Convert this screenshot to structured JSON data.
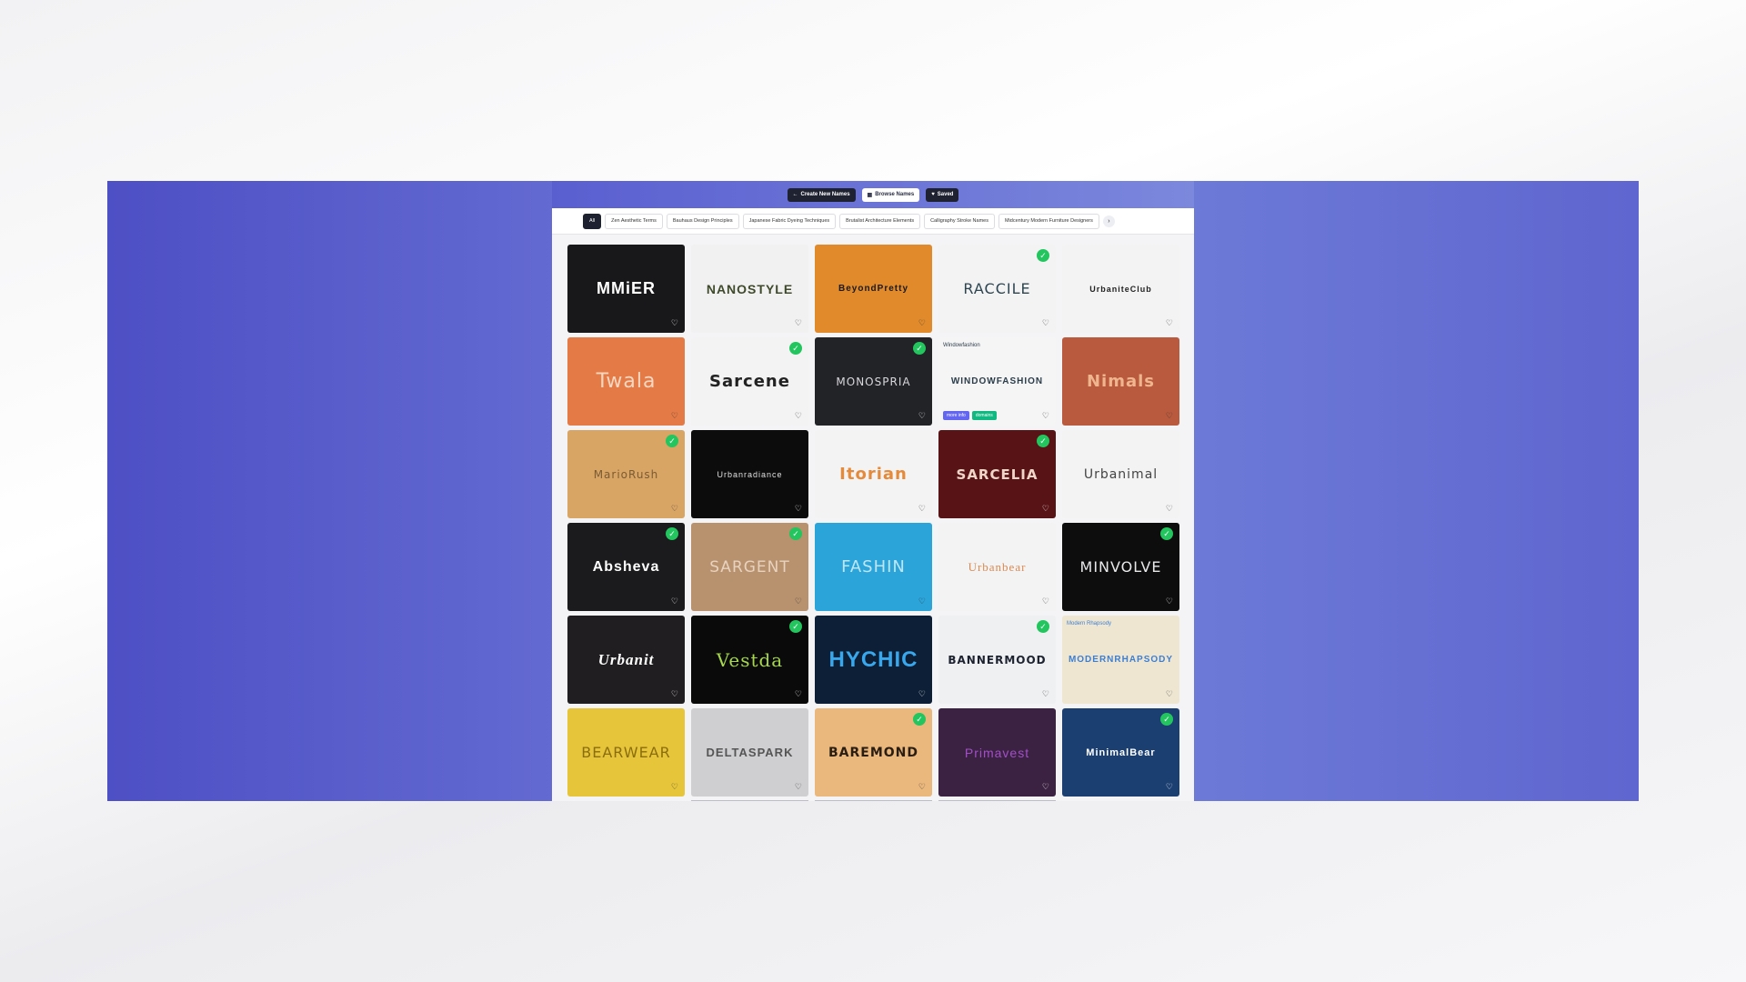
{
  "nav": {
    "create_label": "Create New Names",
    "browse_label": "Browse Names",
    "saved_label": "Saved"
  },
  "categories": [
    "All",
    "Zen Aesthetic Terms",
    "Bauhaus Design Principles",
    "Japanese Fabric Dyeing Techniques",
    "Brutalist Architecture Elements",
    "Calligraphy Stroke Names",
    "Midcentury Modern Furniture Designers"
  ],
  "cards": [
    {
      "name": "MMiER",
      "bg": "#18181b",
      "color": "#ffffff",
      "checked": false
    },
    {
      "name": "NANOSTYLE",
      "bg": "#f1f1f2",
      "color": "#3f4a2a",
      "checked": false
    },
    {
      "name": "BeyondPretty",
      "bg": "#e08a2c",
      "color": "#1a1a1a",
      "checked": false
    },
    {
      "name": "RACCILE",
      "bg": "#f3f3f4",
      "color": "#2d4550",
      "checked": true
    },
    {
      "name": "UrbaniteClub",
      "bg": "#f3f3f4",
      "color": "#222222",
      "checked": false
    },
    {
      "name": "Twala",
      "bg": "#e47a46",
      "color": "#f6d7c1",
      "checked": false
    },
    {
      "name": "Sarcene",
      "bg": "#f3f3f4",
      "color": "#222222",
      "checked": true
    },
    {
      "name": "MONOSPRIA",
      "bg": "#222326",
      "color": "#d8d8dc",
      "checked": true
    },
    {
      "name": "WINDOWFASHION",
      "bg": "#f5f5f6",
      "color": "#2b3d4a",
      "checked": false,
      "sub": "Windowfashion",
      "more": "more info",
      "domains": "domains"
    },
    {
      "name": "Nimals",
      "bg": "#b95a3e",
      "color": "#efb58e",
      "checked": false
    },
    {
      "name": "MarioRush",
      "bg": "#d9a565",
      "color": "#7a5b34",
      "checked": true
    },
    {
      "name": "Urbanradiance",
      "bg": "#0c0c0d",
      "color": "#e0e0e0",
      "checked": false
    },
    {
      "name": "Itorian",
      "bg": "#f3f3f4",
      "color": "#e58a3a",
      "checked": false
    },
    {
      "name": "SARCELIA",
      "bg": "#581316",
      "color": "#f0d6c8",
      "checked": true
    },
    {
      "name": "Urbanimal",
      "bg": "#f3f3f4",
      "color": "#444444",
      "checked": false
    },
    {
      "name": "Absheva",
      "bg": "#1b1b1d",
      "color": "#ffffff",
      "checked": true
    },
    {
      "name": "SARGENT",
      "bg": "#b8916f",
      "color": "#e8d3bf",
      "checked": true
    },
    {
      "name": "FASHIN",
      "bg": "#2ba4da",
      "color": "#bfe6f6",
      "checked": false
    },
    {
      "name": "Urbanbear",
      "bg": "#f3f3f4",
      "color": "#d98a52",
      "checked": false
    },
    {
      "name": "MINVOLVE",
      "bg": "#0d0d0e",
      "color": "#e8e8ea",
      "checked": true
    },
    {
      "name": "Urbanit",
      "bg": "#201e20",
      "color": "#ffffff",
      "checked": false
    },
    {
      "name": "Vestda",
      "bg": "#090a09",
      "color": "#a6d84a",
      "checked": true
    },
    {
      "name": "HYCHIC",
      "bg": "#0c1f36",
      "color": "#38a8ee",
      "checked": false
    },
    {
      "name": "BANNERMOOD",
      "bg": "#eef0f1",
      "color": "#1d2230",
      "checked": true
    },
    {
      "name": "MODERNRHAPSODY",
      "bg": "#efe6d2",
      "color": "#3b7fd4",
      "checked": false,
      "sub": "Modern Rhapsody"
    },
    {
      "name": "BEARWEAR",
      "bg": "#e6c53a",
      "color": "#8a6d0e",
      "checked": false
    },
    {
      "name": "DELTASPARK",
      "bg": "#cfcfd2",
      "color": "#555555",
      "checked": false
    },
    {
      "name": "BAREMOND",
      "bg": "#eab77c",
      "color": "#2a1d12",
      "checked": true
    },
    {
      "name": "Primavest",
      "bg": "#3b2242",
      "color": "#a34ec8",
      "checked": false
    },
    {
      "name": "MinimalBear",
      "bg": "#1c3f72",
      "color": "#ffffff",
      "checked": true
    }
  ]
}
